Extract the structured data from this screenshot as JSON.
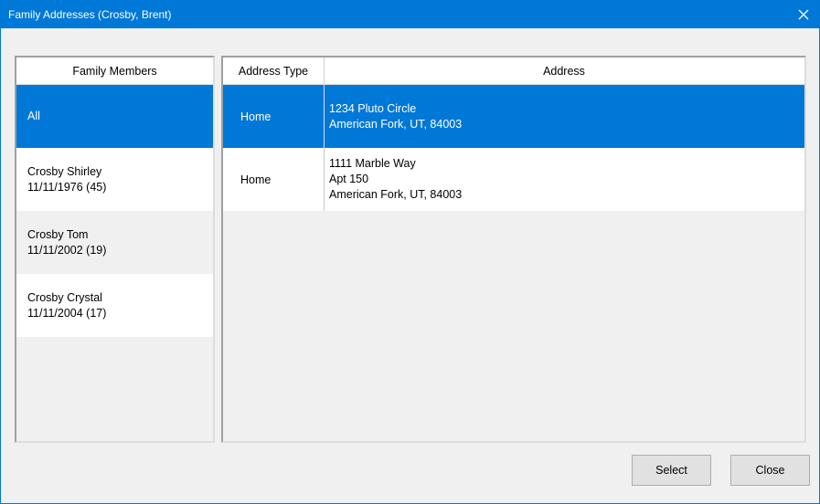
{
  "window": {
    "title": "Family Addresses (Crosby, Brent)",
    "close_icon": "close-x-icon"
  },
  "members_panel": {
    "header": "Family Members",
    "items": [
      {
        "name": "All",
        "dob": "",
        "selected": true
      },
      {
        "name": "Crosby Shirley",
        "dob": "11/11/1976 (45)",
        "selected": false
      },
      {
        "name": "Crosby Tom",
        "dob": "11/11/2002 (19)",
        "selected": false
      },
      {
        "name": "Crosby Crystal",
        "dob": "11/11/2004 (17)",
        "selected": false
      }
    ]
  },
  "address_panel": {
    "headers": {
      "type": "Address Type",
      "address": "Address"
    },
    "rows": [
      {
        "type": "Home",
        "lines": [
          "1234 Pluto Circle",
          "American Fork, UT, 84003"
        ],
        "selected": true
      },
      {
        "type": "Home",
        "lines": [
          "1111 Marble Way",
          "Apt 150",
          "American Fork, UT, 84003"
        ],
        "selected": false
      }
    ]
  },
  "buttons": {
    "select": "Select",
    "close": "Close"
  },
  "colors": {
    "accent": "#0078d7",
    "window_bg": "#f0f0f0"
  }
}
